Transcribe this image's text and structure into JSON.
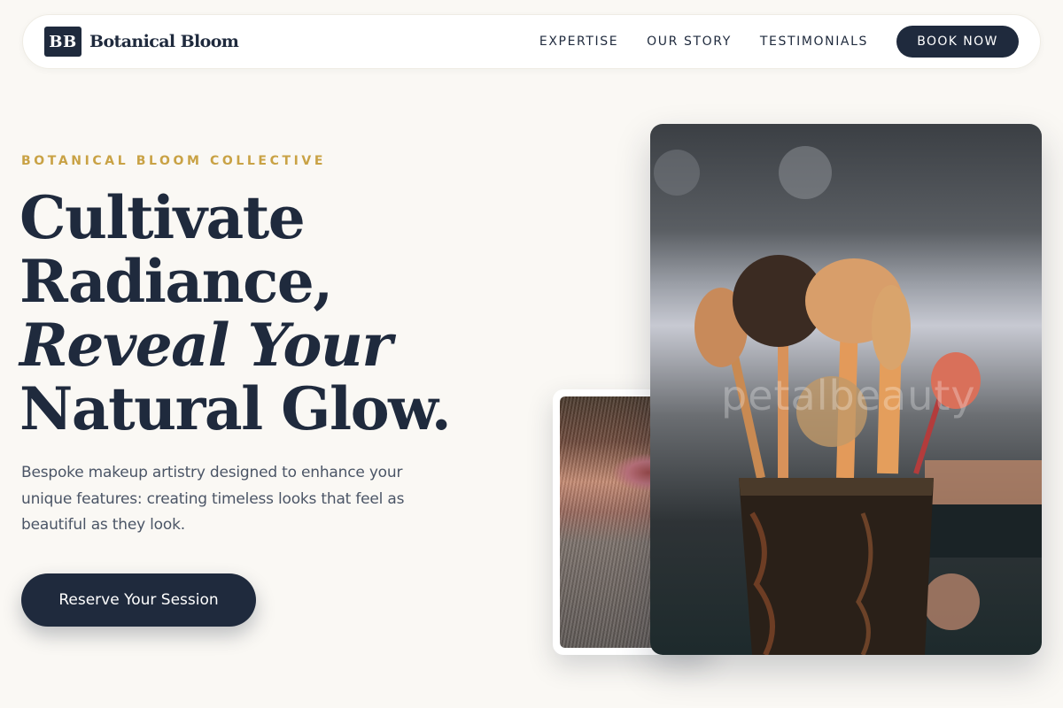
{
  "brand": {
    "mark": "BB",
    "name": "Botanical Bloom"
  },
  "nav": {
    "links": [
      "EXPERTISE",
      "OUR STORY",
      "TESTIMONIALS"
    ],
    "book_label": "BOOK NOW"
  },
  "hero": {
    "eyebrow": "BOTANICAL BLOOM COLLECTIVE",
    "headline": {
      "line1": "Cultivate",
      "line2": "Radiance,",
      "line3": "Reveal Your",
      "line4": "Natural Glow."
    },
    "lede": "Bespoke makeup artistry designed to enhance your unique features: creating timeless looks that feel as beautiful as they look.",
    "cta_label": "Reserve Your Session"
  },
  "images": {
    "main_watermark": "petalbeauty"
  },
  "colors": {
    "navy": "#1f2a3d",
    "gold": "#c9a245",
    "background": "#faf8f4"
  }
}
